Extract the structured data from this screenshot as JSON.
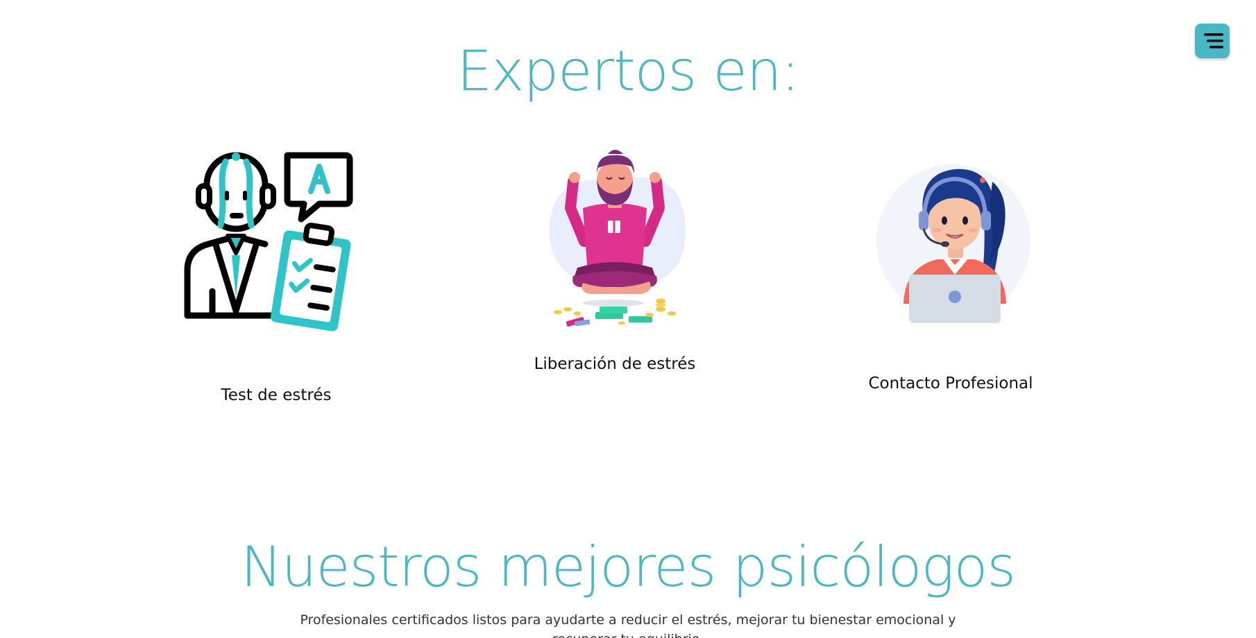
{
  "colors": {
    "accent": "#4ab7c4",
    "text": "#111111",
    "background": "#ffffff"
  },
  "header": {
    "menu_icon": "menu-icon"
  },
  "experts_section": {
    "title": "Expertos en:",
    "services": [
      {
        "label": "Test de estrés",
        "icon": "consultant-checklist-icon"
      },
      {
        "label": "Liberación de estrés",
        "icon": "meditation-illustration"
      },
      {
        "label": "Contacto Profesional",
        "icon": "support-agent-illustration"
      }
    ]
  },
  "psychologists_section": {
    "title": "Nuestros mejores psicólogos",
    "subtitle": "Profesionales certificados listos para ayudarte a reducir el estrés, mejorar tu bienestar emocional y recuperar tu equilibrio."
  }
}
